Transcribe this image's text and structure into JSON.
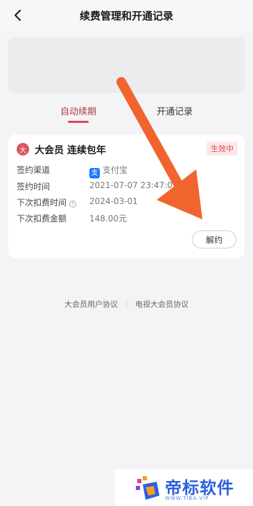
{
  "header": {
    "title": "续费管理和开通记录"
  },
  "tabs": [
    {
      "label": "自动续期",
      "active": true
    },
    {
      "label": "开通记录",
      "active": false
    }
  ],
  "subscription": {
    "badge_char": "大",
    "plan_name": "大会员 连续包年",
    "status": "生效中",
    "rows": [
      {
        "label": "签约渠道",
        "value": "支付宝",
        "icon": "alipay-icon"
      },
      {
        "label": "签约时间",
        "value": "2021-07-07 23:47:05"
      },
      {
        "label": "下次扣费时间",
        "value": "2024-03-01",
        "icon": "info-icon"
      },
      {
        "label": "下次扣费金额",
        "value": "148.00元"
      }
    ],
    "cancel_label": "解约"
  },
  "agreements": {
    "user_agreement": "大会员用户协议",
    "tv_agreement": "电视大会员协议"
  },
  "watermark": {
    "title": "帝标软件",
    "subtitle": "WWW.TIBA.VIP"
  },
  "colors": {
    "accent": "#e04550",
    "arrow": "#f0642e",
    "alipay": "#1677ff"
  }
}
